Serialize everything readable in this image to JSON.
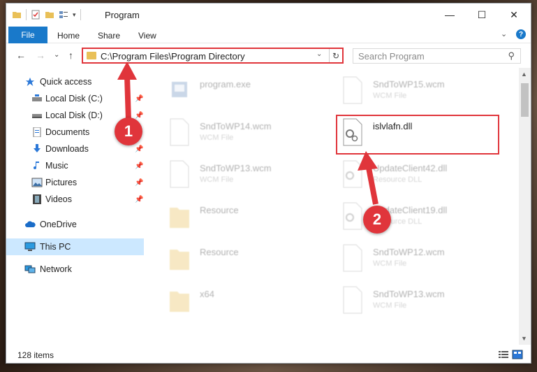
{
  "window": {
    "title": "Program",
    "minimize": "—",
    "maximize": "☐",
    "close": "✕"
  },
  "ribbon": {
    "file": "File",
    "tabs": [
      "Home",
      "Share",
      "View"
    ],
    "help": "?",
    "expand": "⌄"
  },
  "nav": {
    "back": "←",
    "forward": "→",
    "recent": "⌄",
    "up": "↑",
    "address": "C:\\Program Files\\Program Directory",
    "dropdown": "⌄",
    "refresh": "↻",
    "search_placeholder": "Search Program",
    "search_icon": "⚲"
  },
  "sidebar": {
    "items": [
      {
        "label": "Quick access",
        "icon": "star-icon"
      },
      {
        "label": "Local Disk (C:)",
        "icon": "drive-icon"
      },
      {
        "label": "Local Disk (D:)",
        "icon": "drive-icon"
      },
      {
        "label": "Documents",
        "icon": "documents-icon"
      },
      {
        "label": "Downloads",
        "icon": "download-icon"
      },
      {
        "label": "Music",
        "icon": "music-icon"
      },
      {
        "label": "Pictures",
        "icon": "pictures-icon"
      },
      {
        "label": "Videos",
        "icon": "videos-icon"
      },
      {
        "label": "OneDrive",
        "icon": "cloud-icon"
      },
      {
        "label": "This PC",
        "icon": "pc-icon"
      },
      {
        "label": "Network",
        "icon": "network-icon"
      }
    ],
    "pin": "📌"
  },
  "files": [
    {
      "name": "program.exe",
      "type": ""
    },
    {
      "name": "SndToWP15.wcm",
      "type": "WCM File"
    },
    {
      "name": "SndToWP14.wcm",
      "type": "WCM File"
    },
    {
      "name": "islvlafn.dll",
      "type": ""
    },
    {
      "name": "SndToWP13.wcm",
      "type": "WCM File"
    },
    {
      "name": "UpdateClient42.dll",
      "type": "Resource DLL"
    },
    {
      "name": "Resource",
      "type": ""
    },
    {
      "name": "UpdateClient19.dll",
      "type": "Resource DLL"
    },
    {
      "name": "Resource",
      "type": ""
    },
    {
      "name": "SndToWP12.wcm",
      "type": "WCM File"
    },
    {
      "name": "x64",
      "type": ""
    },
    {
      "name": "SndToWP13.wcm",
      "type": "WCM File"
    }
  ],
  "status": {
    "count": "128 items"
  },
  "annotations": {
    "step1": "1",
    "step2": "2",
    "color": "#e0353b"
  }
}
